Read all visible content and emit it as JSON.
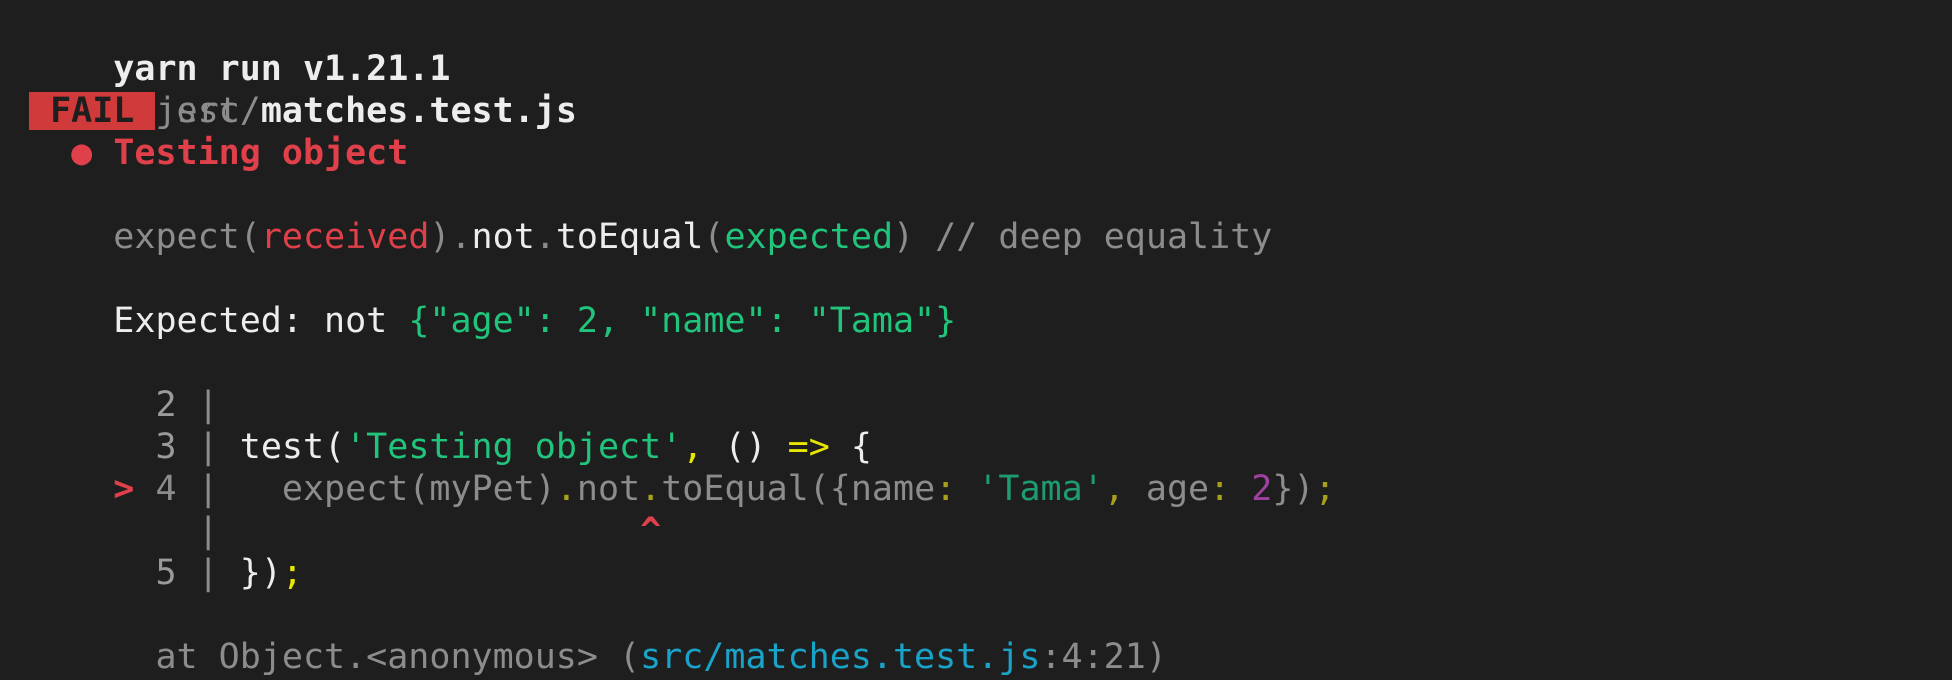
{
  "run_header": "yarn run v1.21.1",
  "command": "$ jest",
  "result": {
    "badge": " FAIL ",
    "file_dir": "src/",
    "file_name": "matches.test.js"
  },
  "test": {
    "bullet": "●",
    "title": "Testing object"
  },
  "matcher": {
    "expect": "expect(",
    "received": "received",
    "close1": ")",
    "dot1": ".",
    "not": "not",
    "dot2": ".",
    "method": "toEqual",
    "open2": "(",
    "expected": "expected",
    "close2": ")",
    "comment": " // deep equality"
  },
  "expected_line": {
    "label": "Expected: not ",
    "value": "{\"age\": 2, \"name\": \"Tama\"}"
  },
  "code_frame": {
    "line2": {
      "num": "2",
      "sep": "|"
    },
    "line3": {
      "num": "3",
      "sep": "|",
      "test": "test(",
      "str": "'Testing object'",
      "comma": ",",
      "parens": " () ",
      "arrow": "=>",
      "brace": " {"
    },
    "line4": {
      "marker": ">",
      "num": "4",
      "sep": "|",
      "expect": "expect(myPet)",
      "dot1": ".",
      "not": "not",
      "dot2": ".",
      "method": "toEqual({name",
      "colon1": ":",
      "space1": " ",
      "str": "'Tama'",
      "comma": ",",
      "age": " age",
      "colon2": ":",
      "space2": " ",
      "num_val": "2",
      "close": "})",
      "semi": ";"
    },
    "caret_line": {
      "sep": "|",
      "caret": "^"
    },
    "line5": {
      "num": "5",
      "sep": "|",
      "close": "})",
      "semi": ";"
    }
  },
  "stack": {
    "prefix": "at Object.<anonymous> (",
    "path": "src/matches.test.js",
    "loc": ":4:21",
    "suffix": ")"
  }
}
